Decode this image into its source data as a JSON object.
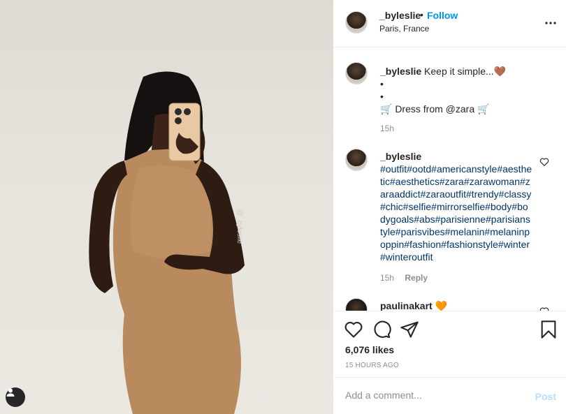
{
  "post": {
    "image_alt": "Mirror selfie of a woman in a tan ribbed dress",
    "watermark": "@_byleslie"
  },
  "header": {
    "username": "_byleslie",
    "dot": "•",
    "follow_label": "Follow",
    "location": "Paris, France",
    "more_label": "•••"
  },
  "caption": {
    "username": "_byleslie",
    "line1": "Keep it simple...🤎",
    "line2": "•",
    "line3": "•",
    "line4": "🛒 Dress from @zara 🛒",
    "time": "15h"
  },
  "comment1": {
    "username": "_byleslie",
    "tags": "#outfit#ootd#americanstyle#aesthetic#aesthetics#zara#zarawoman#zaraaddict#zaraoutfit#trendy#classy#chic#selfie#mirrorselfie#body#bodygoals#abs#parisienne#parisianstyle#parisvibes#melanin#melaninpoppin#fashion#fashionstyle#winter#winteroutfit",
    "time": "15h",
    "reply_label": "Reply"
  },
  "comment2": {
    "username": "paulinakart",
    "emoji": "🧡"
  },
  "stats": {
    "likes": "6,076 likes",
    "time_ago": "15 HOURS AGO"
  },
  "comment_box": {
    "placeholder": "Add a comment...",
    "post_label": "Post"
  },
  "colors": {
    "accent": "#0095f6",
    "hashtag": "#00376b",
    "muted": "#8e8e8e",
    "post_disabled": "#b2dffc"
  }
}
